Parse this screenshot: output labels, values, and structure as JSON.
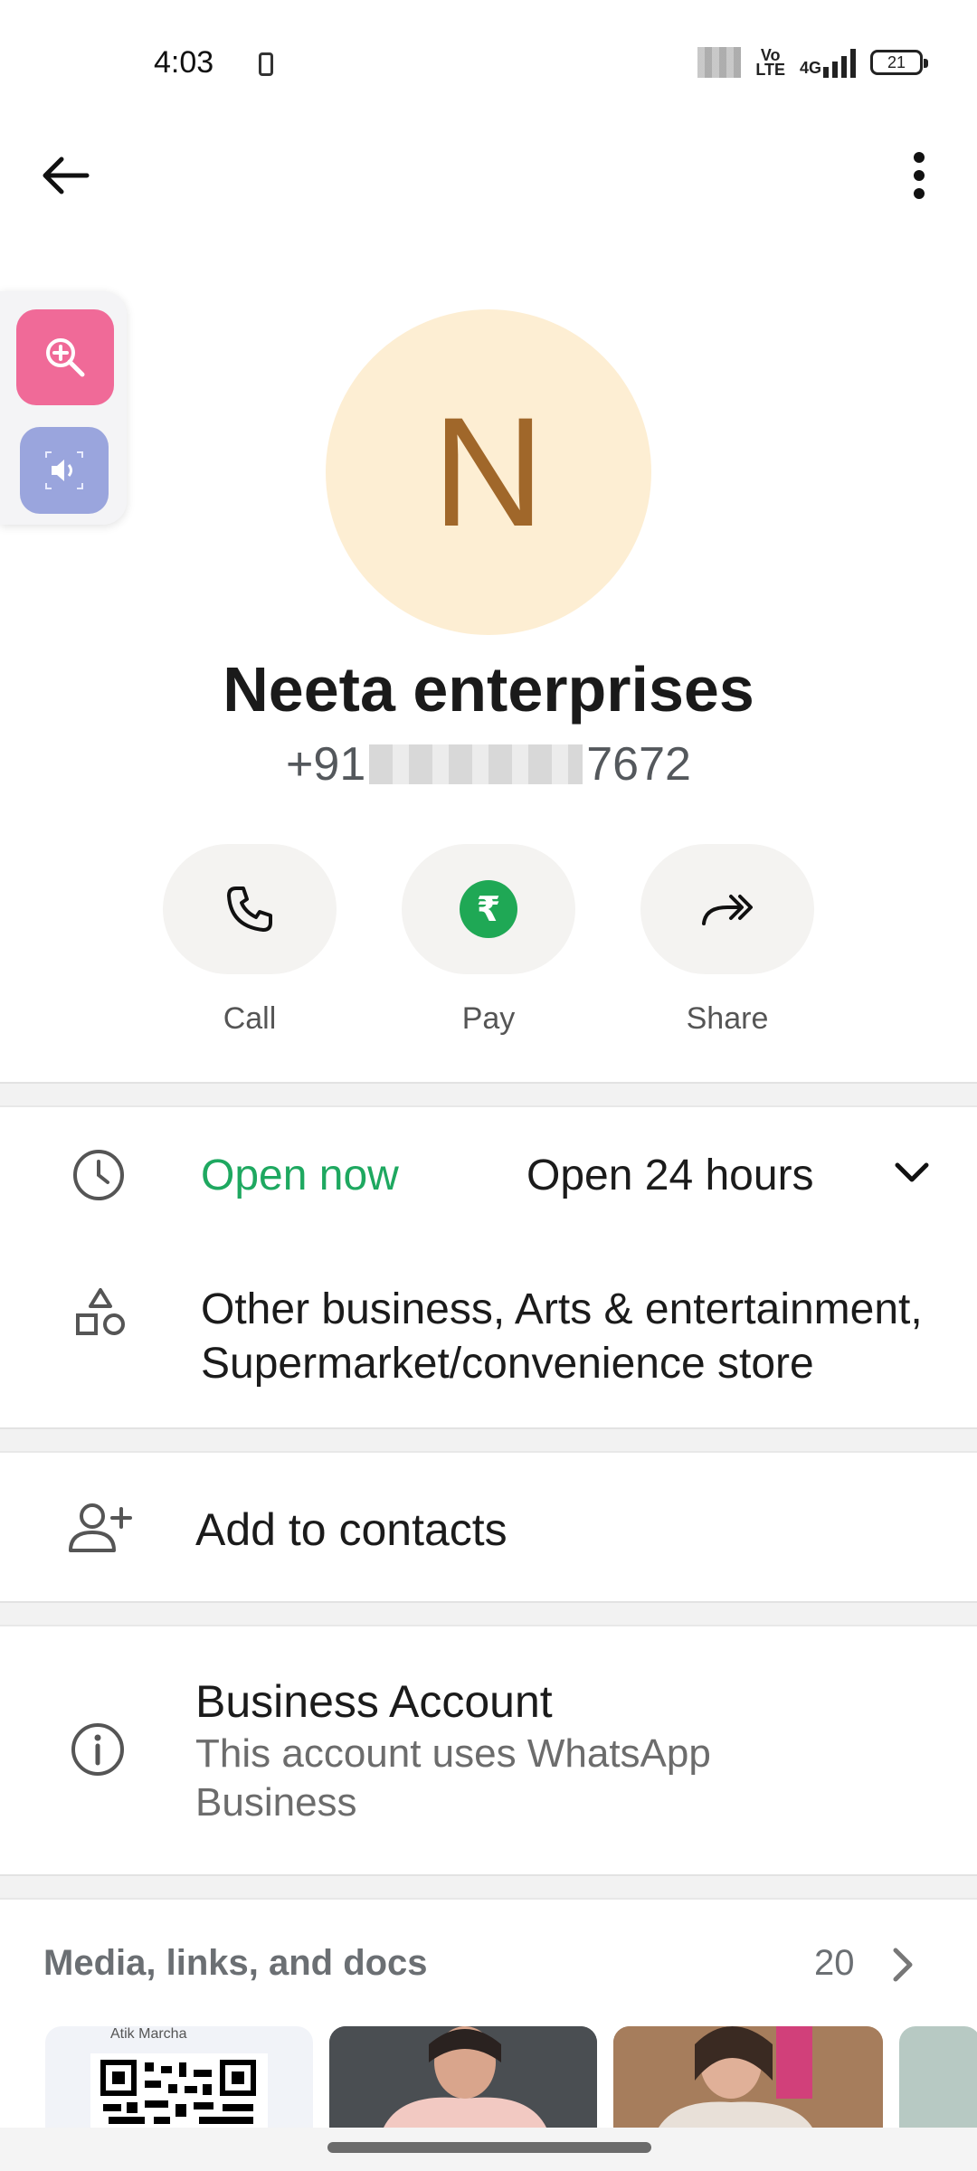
{
  "status_bar": {
    "time": "4:03",
    "volte": "Vo\nLTE",
    "network": "4G",
    "battery": "21"
  },
  "contact": {
    "avatar_letter": "N",
    "name": "Neeta enterprises",
    "phone_prefix": "+91",
    "phone_suffix": "7672"
  },
  "actions": [
    {
      "label": "Call",
      "icon": "phone-icon"
    },
    {
      "label": "Pay",
      "icon": "rupee-icon"
    },
    {
      "label": "Share",
      "icon": "share-arrow-icon"
    }
  ],
  "hours": {
    "status": "Open now",
    "schedule": "Open 24 hours"
  },
  "category": {
    "text": "Other business, Arts & entertainment, Supermarket/convenience store"
  },
  "add_contact": {
    "label": "Add to contacts"
  },
  "business_account": {
    "title": "Business Account",
    "description": "This account uses WhatsApp Business"
  },
  "media": {
    "title": "Media, links, and docs",
    "count": "20",
    "qr_caption": "Atik Marcha"
  },
  "colors": {
    "accent_green": "#1ea860",
    "avatar_bg": "#fdeed3",
    "avatar_letter": "#a0672a",
    "zoom_tool": "#f06a98",
    "sound_tool": "#9aa5dd"
  }
}
